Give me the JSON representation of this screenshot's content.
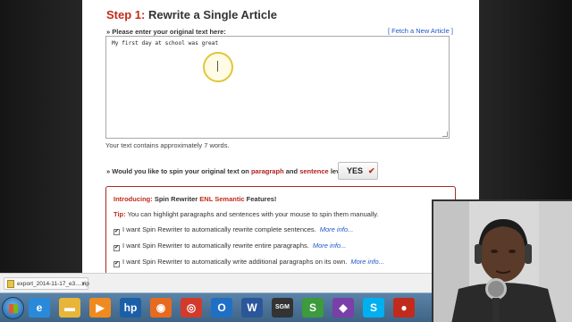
{
  "article": {
    "step_prefix": "Step 1:",
    "step_title": "Rewrite a Single Article",
    "prompt_label": "» Please enter your original text here:",
    "fetch_link": "[ Fetch a New Article ]",
    "original_text": "My first day at school was great",
    "word_count_text": "Your text contains approximately 7 words."
  },
  "spin": {
    "question_prefix": "» Would you like to spin your original text on",
    "paragraph_word": "paragraph",
    "and_word": "and",
    "sentence_word": "sentence",
    "question_suffix": "level?",
    "yes_label": "YES",
    "yes_check": "✔"
  },
  "features": {
    "intro_label": "Introducing:",
    "intro_product": "Spin Rewriter",
    "intro_enl": "ENL Semantic",
    "intro_suffix": "Features!",
    "tip_label": "Tip:",
    "tip_text": "You can highlight paragraphs and sentences with your mouse to spin them manually.",
    "options": [
      {
        "label": "I want Spin Rewriter to automatically rewrite complete sentences.",
        "more": "More info...",
        "checked": true
      },
      {
        "label": "I want Spin Rewriter to automatically rewrite entire paragraphs.",
        "more": "More info...",
        "checked": true
      },
      {
        "label": "I want Spin Rewriter to automatically write additional paragraphs on its own.",
        "more": "More info...",
        "checked": true
      }
    ]
  },
  "downloads": {
    "file_name": "export_2014-11-17_e3....zip",
    "menu_glyph": "▾"
  },
  "taskbar": {
    "icons": [
      {
        "name": "ie-icon",
        "glyph": "e",
        "color": "#2a8ad9"
      },
      {
        "name": "file-explorer-icon",
        "glyph": "▬",
        "color": "#e7b53a"
      },
      {
        "name": "media-player-icon",
        "glyph": "▶",
        "color": "#f08a1e"
      },
      {
        "name": "hp-icon",
        "glyph": "hp",
        "color": "#1b5fa8"
      },
      {
        "name": "firefox-icon",
        "glyph": "◉",
        "color": "#e66b1e"
      },
      {
        "name": "chrome-icon",
        "glyph": "◎",
        "color": "#d23b2b"
      },
      {
        "name": "outlook-icon",
        "glyph": "O",
        "color": "#1f6fc4"
      },
      {
        "name": "word-icon",
        "glyph": "W",
        "color": "#2b579a"
      },
      {
        "name": "sgm-icon",
        "glyph": "SGM",
        "color": "#333333"
      },
      {
        "name": "snagit-icon",
        "glyph": "S",
        "color": "#3d9a3d"
      },
      {
        "name": "app-icon",
        "glyph": "◆",
        "color": "#7a3fa8"
      },
      {
        "name": "skype-icon",
        "glyph": "S",
        "color": "#00aff0"
      },
      {
        "name": "screen-recorder-icon",
        "glyph": "●",
        "color": "#c22b1b"
      }
    ]
  }
}
